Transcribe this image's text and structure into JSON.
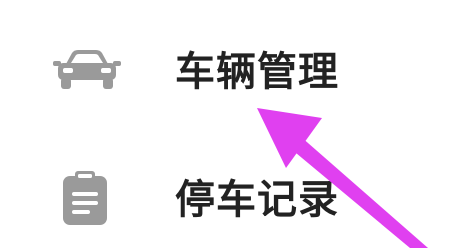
{
  "menu": {
    "items": [
      {
        "label": "车辆管理",
        "icon": "car-icon"
      },
      {
        "label": "停车记录",
        "icon": "clipboard-icon"
      }
    ]
  },
  "colors": {
    "icon_gray": "#9a9a9a",
    "text": "#222222",
    "annotation_arrow": "#e040f0",
    "background": "#ffffff"
  }
}
